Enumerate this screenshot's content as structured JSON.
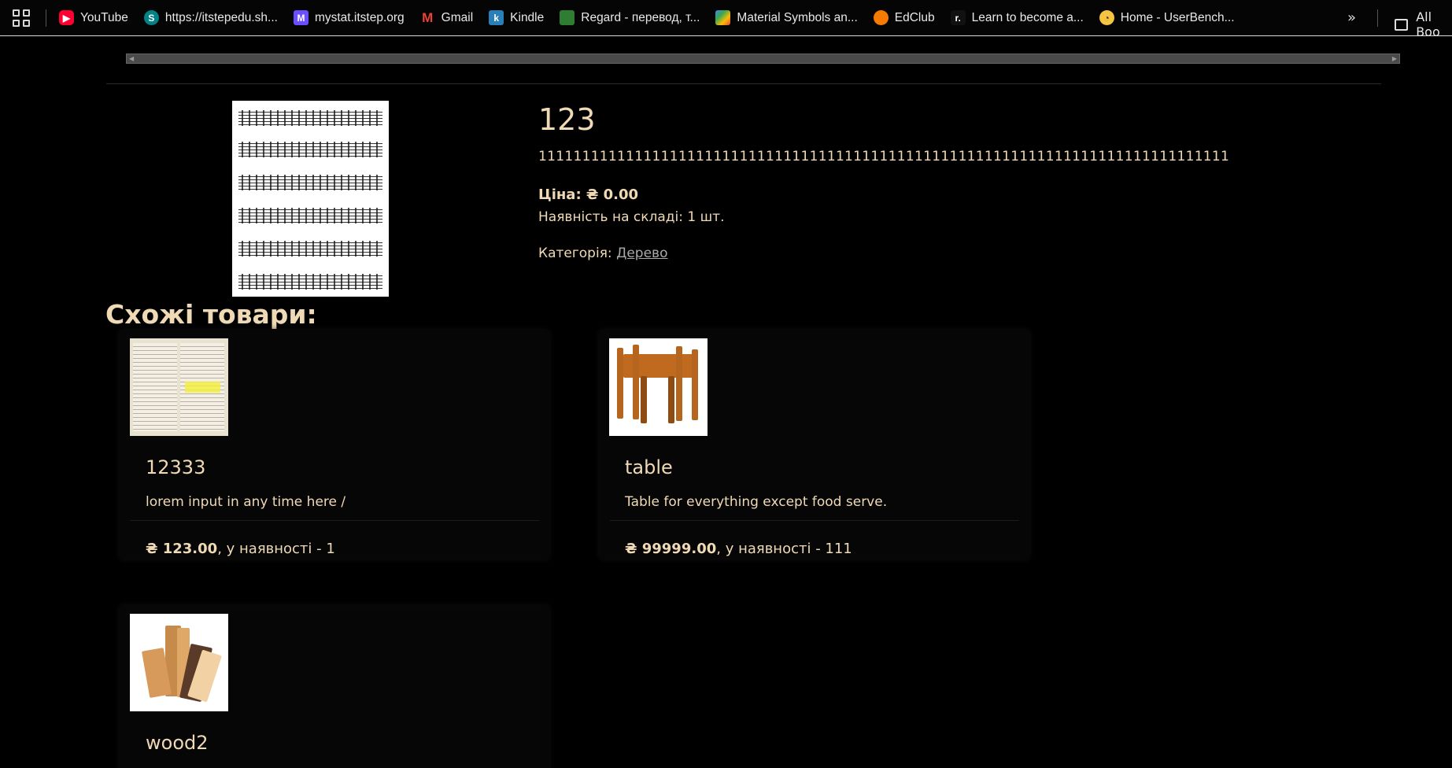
{
  "bookmarks": {
    "items": [
      {
        "label": "YouTube",
        "icon": "youtube-icon",
        "color": "#ff0033"
      },
      {
        "label": "https://itstepedu.sh...",
        "icon": "sharepoint-icon",
        "color": "#038387"
      },
      {
        "label": "mystat.itstep.org",
        "icon": "mystat-icon",
        "color": "#6b4eff"
      },
      {
        "label": "Gmail",
        "icon": "gmail-icon",
        "color": "#ea4335"
      },
      {
        "label": "Kindle",
        "icon": "kindle-icon",
        "color": "#2b7fb8"
      },
      {
        "label": "Regard - перевод, т...",
        "icon": "regard-icon",
        "color": "#2e7d32"
      },
      {
        "label": "Material Symbols an...",
        "icon": "material-icon",
        "color": "#4285f4"
      },
      {
        "label": "EdClub",
        "icon": "edclub-icon",
        "color": "#f57c00"
      },
      {
        "label": "Learn to become a...",
        "icon": "roadmap-icon",
        "color": "#ffffff"
      },
      {
        "label": "Home - UserBench...",
        "icon": "userbench-icon",
        "color": "#f5c542"
      }
    ],
    "more": "»",
    "all_bookmarks": "All Boo"
  },
  "product": {
    "title": "123",
    "description": "1111111111111111111111111111111111111111111111111111111111111111111111111111111",
    "price_label": "Ціна: ₴ 0.00",
    "stock_label": "Наявність на складі: 1 шт.",
    "category_label": "Категорія: ",
    "category_link": "Дерево"
  },
  "similar": {
    "heading": "Схожі товари:",
    "items": [
      {
        "title": "12333",
        "description": "lorem input in any time here /",
        "price": "₴ 123.00",
        "stock": ", у наявності - 1"
      },
      {
        "title": "table",
        "description": "Table for everything except food serve.",
        "price": "₴ 99999.00",
        "stock": ", у наявності - 111"
      },
      {
        "title": "wood2",
        "description": "",
        "price": "",
        "stock": ""
      }
    ]
  },
  "colors": {
    "background": "#000000",
    "text": "#f0d9b5",
    "link": "#aaaaaa"
  }
}
